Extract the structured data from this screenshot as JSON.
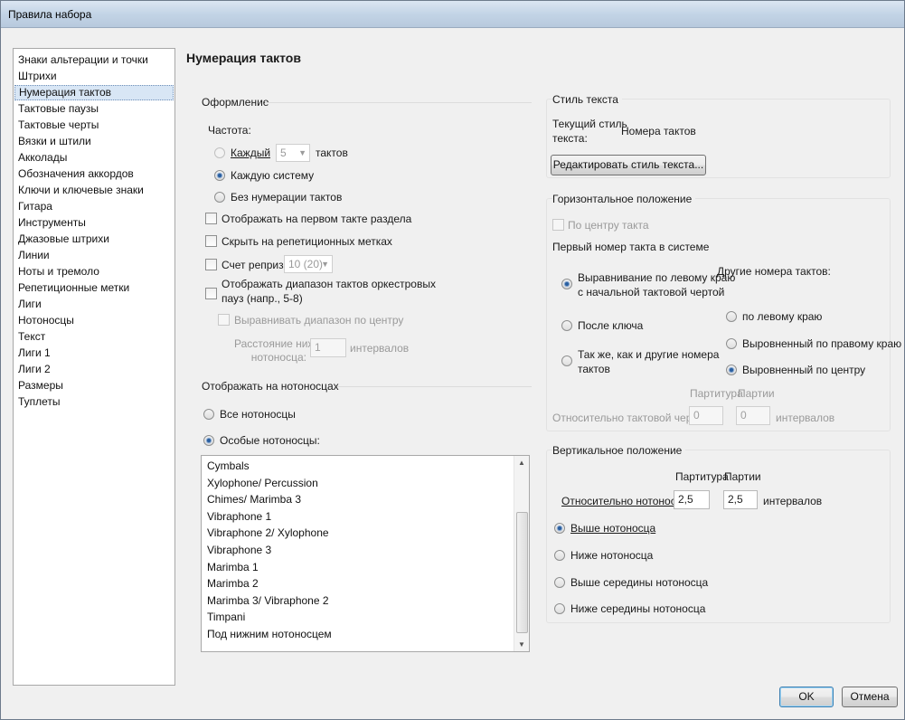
{
  "window": {
    "title": "Правила набора"
  },
  "nav": {
    "items": [
      "Знаки альтерации и точки",
      "Штрихи",
      "Нумерация тактов",
      "Тактовые паузы",
      "Тактовые черты",
      "Вязки и штили",
      "Акколады",
      "Обозначения аккордов",
      "Ключи и ключевые знаки",
      "Гитара",
      "Инструменты",
      "Джазовые штрихи",
      "Линии",
      "Ноты и тремоло",
      "Репетиционные метки",
      "Лиги",
      "Нотоносцы",
      "Текст",
      "Лиги 1",
      "Лиги 2",
      "Размеры",
      "Туплеты"
    ],
    "selected": "Нумерация тактов"
  },
  "page": {
    "title": "Нумерация тактов"
  },
  "appearance": {
    "title": "Оформление",
    "frequency_label": "Частота:",
    "every_label": "Каждый",
    "every_value": "5",
    "bars_label": "тактов",
    "each_system_label": "Каждую систему",
    "no_numbering_label": "Без нумерации тактов",
    "show_first_bar_label": "Отображать на первом такте раздела",
    "hide_rehearsal_label": "Скрыть на репетиционных метках",
    "count_repeats_label": "Счет реприз:",
    "count_repeats_value": "10 (20)",
    "show_range_label_1": "Отображать диапазон тактов оркестровых",
    "show_range_label_2": "пауз (напр., 5-8)",
    "center_range_label": "Выравнивать диапазон по центру",
    "distance_label_1": "Расстояние ниже",
    "distance_label_2": "нотоносца:",
    "distance_value": "1",
    "distance_unit": "интервалов"
  },
  "staves": {
    "title": "Отображать на нотоносцах",
    "all_label": "Все нотоносцы",
    "special_label": "Особые нотоносцы:",
    "list": [
      "Cymbals",
      "Xylophone/ Percussion",
      "Chimes/ Marimba 3",
      "Vibraphone 1",
      "Vibraphone 2/ Xylophone",
      "Vibraphone 3",
      "Marimba 1",
      "Marimba 2",
      "Marimba 3/ Vibraphone 2",
      "Timpani",
      "Под нижним нотоносцем"
    ]
  },
  "text_style": {
    "title": "Стиль текста",
    "current_label_1": "Текущий стиль",
    "current_label_2": "текста:",
    "current_value": "Номера тактов",
    "edit_button": "Редактировать стиль текста..."
  },
  "horizontal": {
    "title": "Горизонтальное положение",
    "center_bar_label": "По центру такта",
    "first_number_label": "Первый номер такта в системе",
    "left_align_label_1": "Выравнивание по левому краю",
    "left_align_label_2": "с начальной тактовой чертой",
    "after_clef_label": "После ключа",
    "same_as_others_label_1": "Так же, как и другие номера",
    "same_as_others_label_2": "тактов",
    "other_numbers_label": "Другие номера тактов:",
    "other_left_label": "по левому краю",
    "other_right_label": "Выровненный по правому краю",
    "other_center_label": "Выровненный по центру",
    "score_label": "Партитура",
    "parts_label": "Партии",
    "relative_barline_label": "Относительно тактовой черты:",
    "score_value": "0",
    "parts_value": "0",
    "unit": "интервалов"
  },
  "vertical": {
    "title": "Вертикальное положение",
    "score_label": "Партитура",
    "parts_label": "Партии",
    "relative_staff_label": "Относительно нотоносца:",
    "score_value": "2,5",
    "parts_value": "2,5",
    "unit": "интервалов",
    "above_label": "Выше нотоносца",
    "below_label": "Ниже нотоносца",
    "above_middle_label": "Выше середины нотоносца",
    "below_middle_label": "Ниже середины нотоносца"
  },
  "buttons": {
    "ok": "OK",
    "cancel": "Отмена"
  }
}
